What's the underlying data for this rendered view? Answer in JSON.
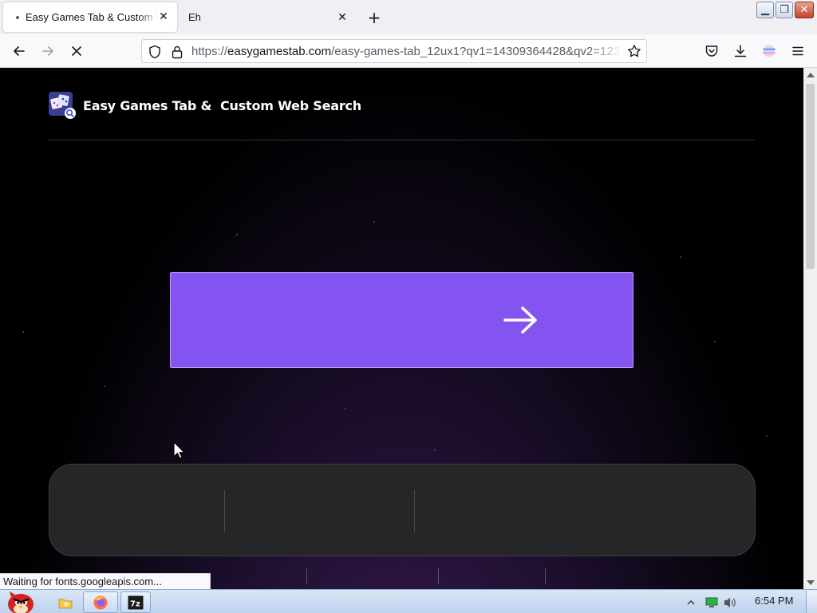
{
  "browser": {
    "tabs": [
      {
        "title": "Easy Games Tab & Custom Web Search",
        "active": true,
        "loading": true
      },
      {
        "title": "Eh",
        "active": false
      }
    ],
    "new_tab_label": "+",
    "url": {
      "scheme": "https://",
      "host": "easygamestab.com",
      "path": "/easy-games-tab_12ux1?qv1=14309364428&qv2=123"
    },
    "status_text": "Waiting for fonts.googleapis.com..."
  },
  "page": {
    "site_title": "Easy Games Tab &  Custom Web Search",
    "accent_color": "#8454f0",
    "search_button_icon": "arrow-right-icon"
  },
  "taskbar": {
    "clock": "6:54 PM",
    "pinned": [
      "angry-birds-icon",
      "explorer-icon",
      "firefox-icon",
      "7zip-icon"
    ]
  }
}
